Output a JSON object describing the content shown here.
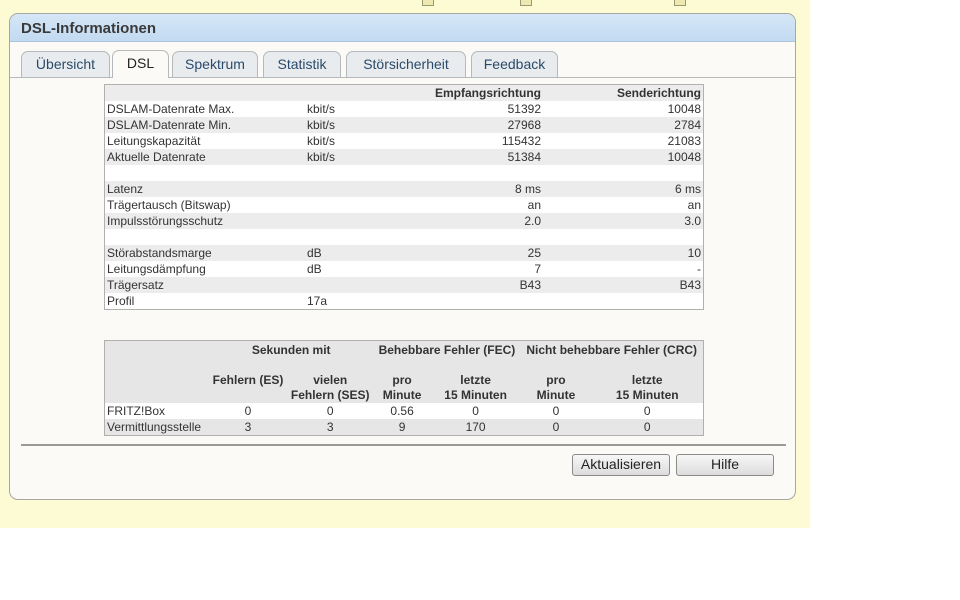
{
  "panel": {
    "title": "DSL-Informationen"
  },
  "tabs": [
    {
      "label": "Übersicht"
    },
    {
      "label": "DSL"
    },
    {
      "label": "Spektrum"
    },
    {
      "label": "Statistik"
    },
    {
      "label": "Störsicherheit"
    },
    {
      "label": "Feedback"
    }
  ],
  "active_tab": "DSL",
  "overview": {
    "headers": {
      "rx": "Empfangsrichtung",
      "tx": "Senderichtung"
    },
    "rows": [
      {
        "label": "DSLAM-Datenrate Max.",
        "unit": "kbit/s",
        "rx": "51392",
        "tx": "10048"
      },
      {
        "label": "DSLAM-Datenrate Min.",
        "unit": "kbit/s",
        "rx": "27968",
        "tx": "2784"
      },
      {
        "label": "Leitungskapazität",
        "unit": "kbit/s",
        "rx": "115432",
        "tx": "21083"
      },
      {
        "label": "Aktuelle Datenrate",
        "unit": "kbit/s",
        "rx": "51384",
        "tx": "10048"
      },
      {
        "label": "Latenz",
        "unit": "",
        "rx": "8 ms",
        "tx": "6 ms"
      },
      {
        "label": "Trägertausch (Bitswap)",
        "unit": "",
        "rx": "an",
        "tx": "an"
      },
      {
        "label": "Impulsstörungsschutz",
        "unit": "",
        "rx": "2.0",
        "tx": "3.0"
      },
      {
        "label": "Störabstandsmarge",
        "unit": "dB",
        "rx": "25",
        "tx": "10"
      },
      {
        "label": "Leitungsdämpfung",
        "unit": "dB",
        "rx": "7",
        "tx": "-"
      },
      {
        "label": "Trägersatz",
        "unit": "",
        "rx": "B43",
        "tx": "B43"
      },
      {
        "label": "Profil",
        "unit": "17a",
        "rx": "",
        "tx": ""
      }
    ]
  },
  "errors": {
    "group_headers": {
      "seconds": "Sekunden mit",
      "fec": "Behebbare Fehler (FEC)",
      "crc": "Nicht behebbare Fehler (CRC)"
    },
    "sub_headers": {
      "es": "Fehlern (ES)",
      "ses_1": "vielen",
      "ses_2": "Fehlern (SES)",
      "per_1": "pro",
      "per_2": "Minute",
      "last_1": "letzte",
      "last_2": "15 Minuten"
    },
    "rows": [
      {
        "label": "FRITZ!Box",
        "es": "0",
        "ses": "0",
        "fec_min": "0.56",
        "fec_15": "0",
        "crc_min": "0",
        "crc_15": "0"
      },
      {
        "label": "Vermittlungsstelle",
        "es": "3",
        "ses": "3",
        "fec_min": "9",
        "fec_15": "170",
        "crc_min": "0",
        "crc_15": "0"
      }
    ]
  },
  "buttons": {
    "refresh": "Aktualisieren",
    "help": "Hilfe"
  },
  "colors": {
    "header_blue": "#c8def3",
    "page_yellow": "#fdfbd3"
  }
}
